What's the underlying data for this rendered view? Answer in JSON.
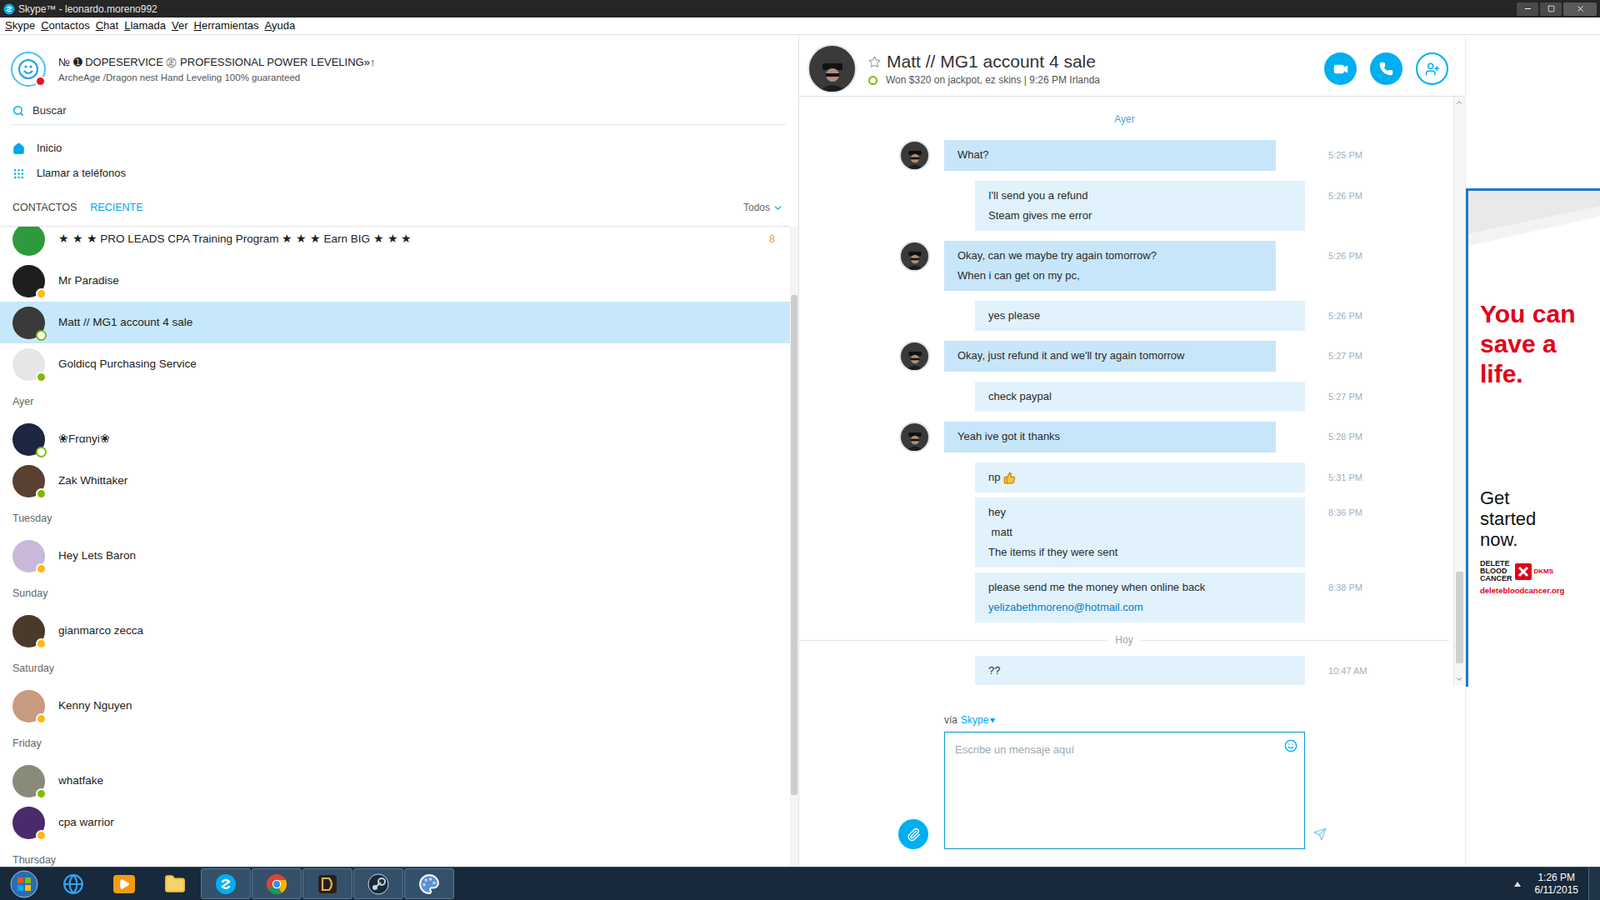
{
  "window": {
    "title": "Skype™ - leonardo.moreno992"
  },
  "menu": [
    "Skype",
    "Contactos",
    "Chat",
    "Llamada",
    "Ver",
    "Herramientas",
    "Ayuda"
  ],
  "profile": {
    "name": "№ ➊ DOPESERVICE ㊣ PROFESSIONAL POWER LEVELING»↑",
    "mood": "ArcheAge /Dragon nest Hand Leveling 100% guaranteed",
    "status": "busy"
  },
  "search": {
    "placeholder": "Buscar"
  },
  "nav": [
    {
      "label": "Inicio"
    },
    {
      "label": "Llamar a teléfonos"
    }
  ],
  "tabs": [
    {
      "label": "CONTACTOS",
      "selected": false
    },
    {
      "label": "RECIENTE",
      "selected": true
    }
  ],
  "filter": {
    "label": "Todos"
  },
  "recent": [
    {
      "kind": "contact",
      "name": "★ ★ ★ PRO LEADS CPA Training Program ★ ★ ★ Earn BIG ★ ★ ★",
      "status": "none",
      "badge": "8",
      "selected": false,
      "color": "#2f9a3c"
    },
    {
      "kind": "contact",
      "name": "Mr Paradise",
      "status": "away",
      "badge": "",
      "selected": false,
      "color": "#1e1e1e"
    },
    {
      "kind": "contact",
      "name": "Matt // MG1 account 4 sale",
      "status": "idle",
      "badge": "",
      "selected": true,
      "color": "#3a3a3a"
    },
    {
      "kind": "contact",
      "name": "Goldicq Purchasing Service",
      "status": "online",
      "badge": "",
      "selected": false,
      "color": "#e6e6e6"
    },
    {
      "kind": "header",
      "label": "Ayer"
    },
    {
      "kind": "contact",
      "name": "❀Frαnyi❀",
      "status": "idle",
      "badge": "",
      "selected": false,
      "color": "#1c2640"
    },
    {
      "kind": "contact",
      "name": "Zak Whittaker",
      "status": "online",
      "badge": "",
      "selected": false,
      "color": "#5a4030"
    },
    {
      "kind": "header",
      "label": "Tuesday"
    },
    {
      "kind": "contact",
      "name": "Hey Lets Baron",
      "status": "away",
      "badge": "",
      "selected": false,
      "color": "#c9b8d8"
    },
    {
      "kind": "header",
      "label": "Sunday"
    },
    {
      "kind": "contact",
      "name": "gianmarco zecca",
      "status": "away",
      "badge": "",
      "selected": false,
      "color": "#4a3a2a"
    },
    {
      "kind": "header",
      "label": "Saturday"
    },
    {
      "kind": "contact",
      "name": "Kenny Nguyen",
      "status": "away",
      "badge": "",
      "selected": false,
      "color": "#c89a80"
    },
    {
      "kind": "header",
      "label": "Friday"
    },
    {
      "kind": "contact",
      "name": "whatfake",
      "status": "online",
      "badge": "",
      "selected": false,
      "color": "#8a8a7a"
    },
    {
      "kind": "contact",
      "name": "cpa warrior",
      "status": "away",
      "badge": "",
      "selected": false,
      "color": "#4a2a6a"
    },
    {
      "kind": "header",
      "label": "Thursday"
    }
  ],
  "chat": {
    "name": "Matt // MG1 account 4 sale",
    "mood": "Won $320 on jackpot, ez skins | 9:26 PM Irlanda",
    "status": "idle",
    "favorite": false,
    "items": [
      {
        "kind": "day",
        "label": "Ayer"
      },
      {
        "kind": "message",
        "from": "them",
        "lines": [
          "What?"
        ],
        "link": "",
        "emoticon": false,
        "time": "5:25 PM"
      },
      {
        "kind": "message",
        "from": "me",
        "lines": [
          "I'll send you a refund",
          "Steam gives me error"
        ],
        "link": "",
        "emoticon": false,
        "time": "5:26 PM"
      },
      {
        "kind": "message",
        "from": "them",
        "lines": [
          "Okay, can we maybe try again tomorrow?",
          "When i can get on my pc,"
        ],
        "link": "",
        "emoticon": false,
        "time": "5:26 PM"
      },
      {
        "kind": "message",
        "from": "me",
        "lines": [
          "yes please"
        ],
        "link": "",
        "emoticon": false,
        "time": "5:26 PM"
      },
      {
        "kind": "message",
        "from": "them",
        "lines": [
          "Okay, just refund it and we'll try again tomorrow"
        ],
        "link": "",
        "emoticon": false,
        "time": "5:27 PM"
      },
      {
        "kind": "message",
        "from": "me",
        "lines": [
          "check paypal"
        ],
        "link": "",
        "emoticon": false,
        "time": "5:27 PM"
      },
      {
        "kind": "message",
        "from": "them",
        "lines": [
          "Yeah ive got it thanks"
        ],
        "link": "",
        "emoticon": false,
        "time": "5:28 PM"
      },
      {
        "kind": "message",
        "from": "me",
        "lines": [
          "np"
        ],
        "link": "",
        "emoticon": true,
        "time": "5:31 PM"
      },
      {
        "kind": "message",
        "from": "me",
        "lines": [
          "hey",
          " matt",
          "The items if they were sent"
        ],
        "link": "",
        "emoticon": false,
        "time": "8:36 PM"
      },
      {
        "kind": "message",
        "from": "me",
        "lines": [
          "please send me the money when online back"
        ],
        "link": "yelizabethmoreno@hotmail.com",
        "emoticon": false,
        "time": "8:38 PM"
      },
      {
        "kind": "day_divider",
        "label": "Hoy"
      },
      {
        "kind": "message",
        "from": "me",
        "lines": [
          "??"
        ],
        "link": "",
        "emoticon": false,
        "time": "10:47 AM"
      }
    ]
  },
  "composer": {
    "via": "vía",
    "service": "Skype",
    "arrow": "▾",
    "placeholder": "Escribe un mensaje aquí"
  },
  "ad": {
    "headline": [
      "You can",
      "save a",
      "life."
    ],
    "cta": [
      "Get",
      "started",
      "now."
    ],
    "logo": [
      "DELETE",
      "BLOOD",
      "CANCER"
    ],
    "logo_mark": "DKMS",
    "url": "deletebloodcancer.org"
  },
  "taskbar": {
    "time": "1:26 PM",
    "date": "6/11/2015",
    "apps": [
      {
        "running": false
      },
      {
        "running": false
      },
      {
        "running": false
      },
      {
        "running": true
      },
      {
        "running": true
      },
      {
        "running": true
      },
      {
        "running": true
      },
      {
        "running": true
      }
    ]
  }
}
